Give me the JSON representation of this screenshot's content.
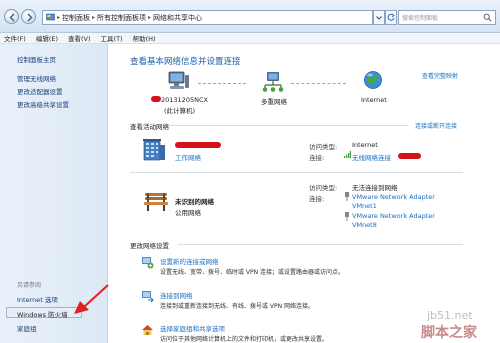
{
  "address_bar": {
    "crumbs": [
      "控制面板",
      "所有控制面板项",
      "网络和共享中心"
    ],
    "search_placeholder": "搜索控制面板"
  },
  "menu": [
    "文件(F)",
    "编辑(E)",
    "查看(V)",
    "工具(T)",
    "帮助(H)"
  ],
  "left_pane": {
    "home": "控制面板主页",
    "tasks": [
      "管理无线网络",
      "更改适配器设置",
      "更改高级共享设置"
    ],
    "see_also_heading": "另请参阅",
    "see_also": [
      "Internet 选项",
      "Windows 防火墙",
      "家庭组"
    ]
  },
  "main": {
    "title": "查看基本网络信息并设置连接",
    "full_map_link": "查看完整映射",
    "map": {
      "computer_name": "20131205NCX",
      "computer_sub": "(此计算机)",
      "middle": "多重网络",
      "internet": "Internet"
    },
    "active_heading": "查看活动网络",
    "connect_link": "连接或断开连接",
    "networks": [
      {
        "type": "工作网络",
        "access_label": "访问类型:",
        "access_value": "Internet",
        "conn_label": "连接:",
        "conn_value": "无线网络连接"
      },
      {
        "name": "未识别的网络",
        "type": "公用网络",
        "access_label": "访问类型:",
        "access_value": "无法连接到网络",
        "conn_label": "连接:",
        "adapters": [
          "VMware Network Adapter",
          "VMnet1",
          "VMware Network Adapter",
          "VMnet8"
        ]
      }
    ],
    "change_heading": "更改网络设置",
    "settings": [
      {
        "link": "设置新的连接或网络",
        "desc": "设置无线、宽带、拨号、临时或 VPN 连接；或设置路由器或访问点。"
      },
      {
        "link": "连接到网络",
        "desc": "连接到或重新连接到无线、有线、拨号或 VPN 网络连接。"
      },
      {
        "link": "选择家庭组和共享选项",
        "desc": "访问位于其他网络计算机上的文件和打印机，或更改共享设置。"
      }
    ]
  },
  "watermark": {
    "line1": "jb51.net",
    "line2": "脚本之家"
  },
  "colors": {
    "link": "#1a6fc2",
    "title": "#1a5fa8",
    "redaction": "#d2141a",
    "arrow": "#e02020"
  }
}
